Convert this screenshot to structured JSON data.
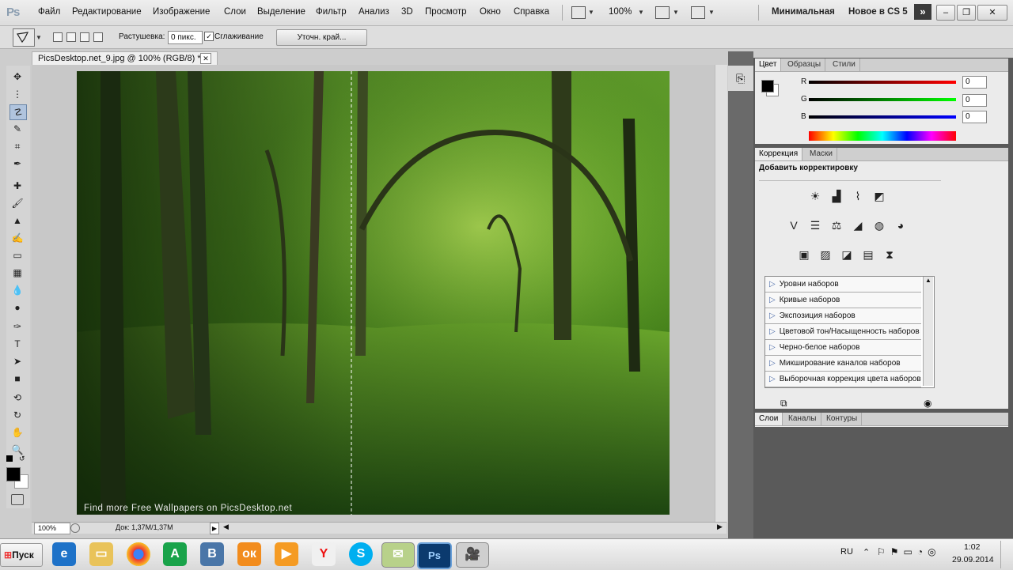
{
  "menubar": {
    "logo": "Ps",
    "items": [
      "Файл",
      "Редактирование",
      "Изображение",
      "Слои",
      "Выделение",
      "Фильтр",
      "Анализ",
      "3D",
      "Просмотр",
      "Окно",
      "Справка"
    ],
    "zoom": "100%",
    "workspaces": [
      "Минимальная",
      "Новое в CS 5"
    ],
    "more": "»"
  },
  "options": {
    "feather_label": "Растушевка:",
    "feather_value": "0 пикс.",
    "antialias_label": "Сглаживание",
    "antialias_check": "✓",
    "refine_button": "Уточн. край..."
  },
  "document": {
    "tab_title": "PicsDesktop.net_9.jpg @ 100% (RGB/8) *",
    "watermark": "Find more Free Wallpapers on PicsDesktop.net"
  },
  "statusbar": {
    "zoom": "100%",
    "doc_info": "Док: 1,37M/1,37M"
  },
  "color_panel": {
    "tabs": [
      "Цвет",
      "Образцы",
      "Стили"
    ],
    "r_label": "R",
    "g_label": "G",
    "b_label": "B",
    "r_value": "0",
    "g_value": "0",
    "b_value": "0"
  },
  "adjustments_panel": {
    "tabs": [
      "Коррекция",
      "Маски"
    ],
    "heading": "Добавить корректировку",
    "presets": [
      "Уровни наборов",
      "Кривые наборов",
      "Экспозиция наборов",
      "Цветовой тон/Насыщенность наборов",
      "Черно-белое наборов",
      "Микширование каналов наборов",
      "Выборочная коррекция цвета наборов"
    ]
  },
  "layers_panel": {
    "tabs": [
      "Слои",
      "Каналы",
      "Контуры"
    ]
  },
  "taskbar": {
    "start": "Пуск",
    "lang": "RU",
    "time": "1:02",
    "date": "29.09.2014",
    "apps": [
      "Internet Explorer",
      "Проводник",
      "Chrome",
      "Green A",
      "B",
      "Одноклассники",
      "Media",
      "Яндекс",
      "Skype",
      "Notes",
      "Photoshop",
      "Camera"
    ]
  }
}
